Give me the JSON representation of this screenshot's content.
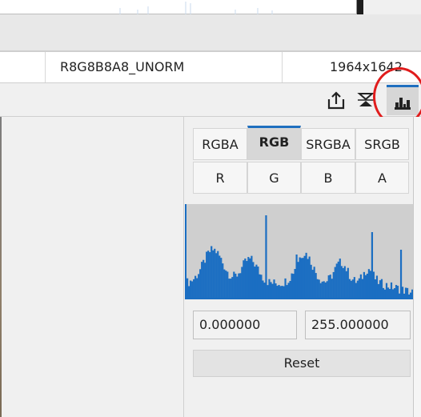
{
  "info_bar": {
    "format": "R8G8B8A8_UNORM",
    "dimensions": "1964x1642"
  },
  "toolbar": {
    "icons": [
      "export-icon",
      "flip-icon",
      "histogram-icon"
    ],
    "active": "histogram-icon",
    "highlight_color": "#e01c1c"
  },
  "histogram_panel": {
    "modes": [
      {
        "label": "RGBA",
        "selected": false
      },
      {
        "label": "RGB",
        "selected": true
      },
      {
        "label": "SRGBA",
        "selected": false
      },
      {
        "label": "SRGB",
        "selected": false
      }
    ],
    "channels": [
      "R",
      "G",
      "B",
      "A"
    ],
    "min_value": "0.000000",
    "max_value": "255.000000",
    "reset_label": "Reset",
    "bar_color": "#1b6ec2",
    "accent_color": "#1f6fbf"
  }
}
